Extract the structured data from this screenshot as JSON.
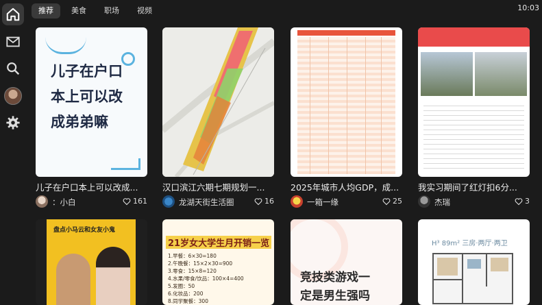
{
  "status": {
    "time": "10:03"
  },
  "sidebar": {
    "items": [
      {
        "icon": "home-icon"
      },
      {
        "icon": "mail-icon"
      },
      {
        "icon": "search-icon"
      },
      {
        "icon": "avatar"
      },
      {
        "icon": "gear-icon"
      }
    ]
  },
  "tabs": [
    {
      "label": "推荐",
      "active": true
    },
    {
      "label": "美食"
    },
    {
      "label": "职场"
    },
    {
      "label": "视频"
    }
  ],
  "feed": [
    {
      "title": "儿子在户口本上可以改成...",
      "thumb_text": [
        "儿子在户口",
        "本上可以改",
        "成弟弟嘛"
      ],
      "author": "：小白",
      "likes": "161"
    },
    {
      "title": "汉口滨江六期七期规划一...",
      "author": "龙湖天街生活圈",
      "likes": "16"
    },
    {
      "title": "2025年城市人均GDP，成...",
      "author": "一箱一缘",
      "likes": "25"
    },
    {
      "title": "我实习期间了红灯扣6分...",
      "author": "杰瑞",
      "likes": "3"
    },
    {
      "thumb_text": [
        "盘点小马云和女友小鬼"
      ]
    },
    {
      "thumb_head": "21岁女大学生月开销一览",
      "thumb_lines": [
        "1.早餐：6×30=180",
        "2.午晚餐：15×2×30=900",
        "3.零食：15×8=120",
        "4.水果/零食/饮品：100×4=400",
        "5.发圈：50",
        "6.化妆品：200",
        "7.话费/流量：50",
        "8.同学聚餐：300"
      ]
    },
    {
      "thumb_text": [
        "竞技类游戏一",
        "定是男生强吗"
      ]
    },
    {
      "thumb_label": "H³ 89m²  三房·两厅·两卫"
    }
  ],
  "colors": {
    "accent": "#3a3a3a",
    "bg": "#1b1b1b"
  }
}
